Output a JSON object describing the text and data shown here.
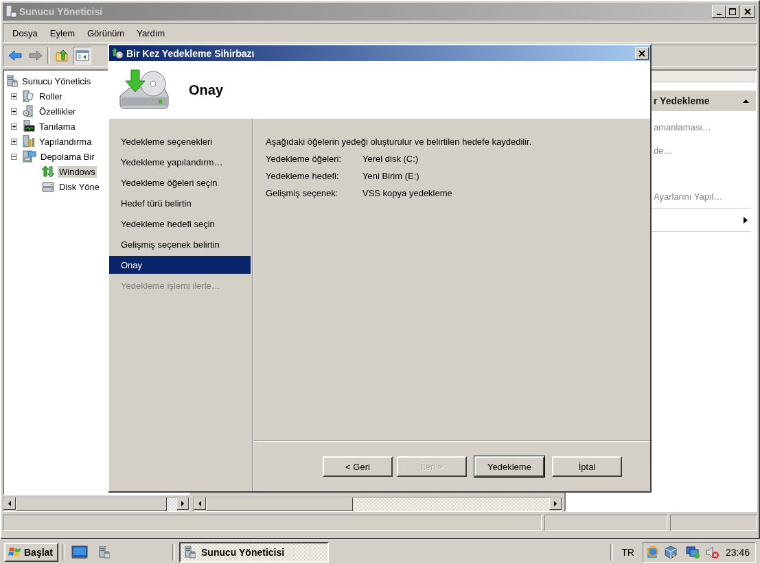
{
  "main_window": {
    "title": "Sunucu Yöneticisi"
  },
  "menu": [
    "Dosya",
    "Eylem",
    "Görünüm",
    "Yardım"
  ],
  "tree": {
    "root": {
      "label": "Sunucu Yöneticis",
      "selected": false
    },
    "items": [
      {
        "label": "Roller",
        "expanded": false,
        "selected": false
      },
      {
        "label": "Özellikler",
        "expanded": false,
        "selected": false
      },
      {
        "label": "Tanılama",
        "expanded": false,
        "selected": false
      },
      {
        "label": "Yapılandırma",
        "expanded": false,
        "selected": false
      },
      {
        "label": "Depolama Bir",
        "expanded": true,
        "selected": false,
        "children": [
          {
            "label": "Windows",
            "selected": true
          },
          {
            "label": "Disk Yöne",
            "selected": false
          }
        ]
      }
    ]
  },
  "actions_pane": {
    "header": "r Yedekleme",
    "items": [
      {
        "kind": "link",
        "label": "amanlaması…"
      },
      {
        "kind": "link",
        "label": "de…"
      },
      {
        "kind": "link",
        "label": "Ayarlarını Yapıl…"
      },
      {
        "kind": "submenu"
      }
    ]
  },
  "dialog": {
    "title": "Bir Kez Yedekleme Sihirbazı",
    "heading": "Onay",
    "steps": [
      {
        "label": "Yedekleme seçenekleri",
        "selected": false,
        "disabled": false
      },
      {
        "label": "Yedekleme yapılandırm…",
        "selected": false,
        "disabled": false
      },
      {
        "label": "Yedekleme öğeleri seçin",
        "selected": false,
        "disabled": false
      },
      {
        "label": "Hedef türü belirtin",
        "selected": false,
        "disabled": false
      },
      {
        "label": "Yedekleme hedefi seçin",
        "selected": false,
        "disabled": false
      },
      {
        "label": "Gelişmiş seçenek belirtin",
        "selected": false,
        "disabled": false
      },
      {
        "label": "Onay",
        "selected": true,
        "disabled": false
      },
      {
        "label": "Yedekleme işlemi ilerle…",
        "selected": false,
        "disabled": true
      }
    ],
    "intro": "Aşağıdaki öğelerin yedeği oluşturulur ve belirtilen hedefe kaydedilir.",
    "details": [
      {
        "label": "Yedekleme öğeleri:",
        "value": "Yerel disk (C:)"
      },
      {
        "label": "Yedekleme hedefi:",
        "value": "Yeni Birim (E:)"
      },
      {
        "label": "Gelişmiş seçenek:",
        "value": "VSS kopya yedekleme"
      }
    ],
    "buttons": [
      {
        "label": "< Geri",
        "disabled": false,
        "default": false
      },
      {
        "label": "İleri >",
        "disabled": true,
        "default": false
      },
      {
        "label": "Yedekleme",
        "disabled": false,
        "default": true
      },
      {
        "label": "İptal",
        "disabled": false,
        "default": false
      }
    ]
  },
  "taskbar": {
    "start": "Başlat",
    "tasks": [
      {
        "label": "Sunucu Yöneticisi",
        "selected": true
      }
    ],
    "language": "TR",
    "clock": "23:46"
  }
}
